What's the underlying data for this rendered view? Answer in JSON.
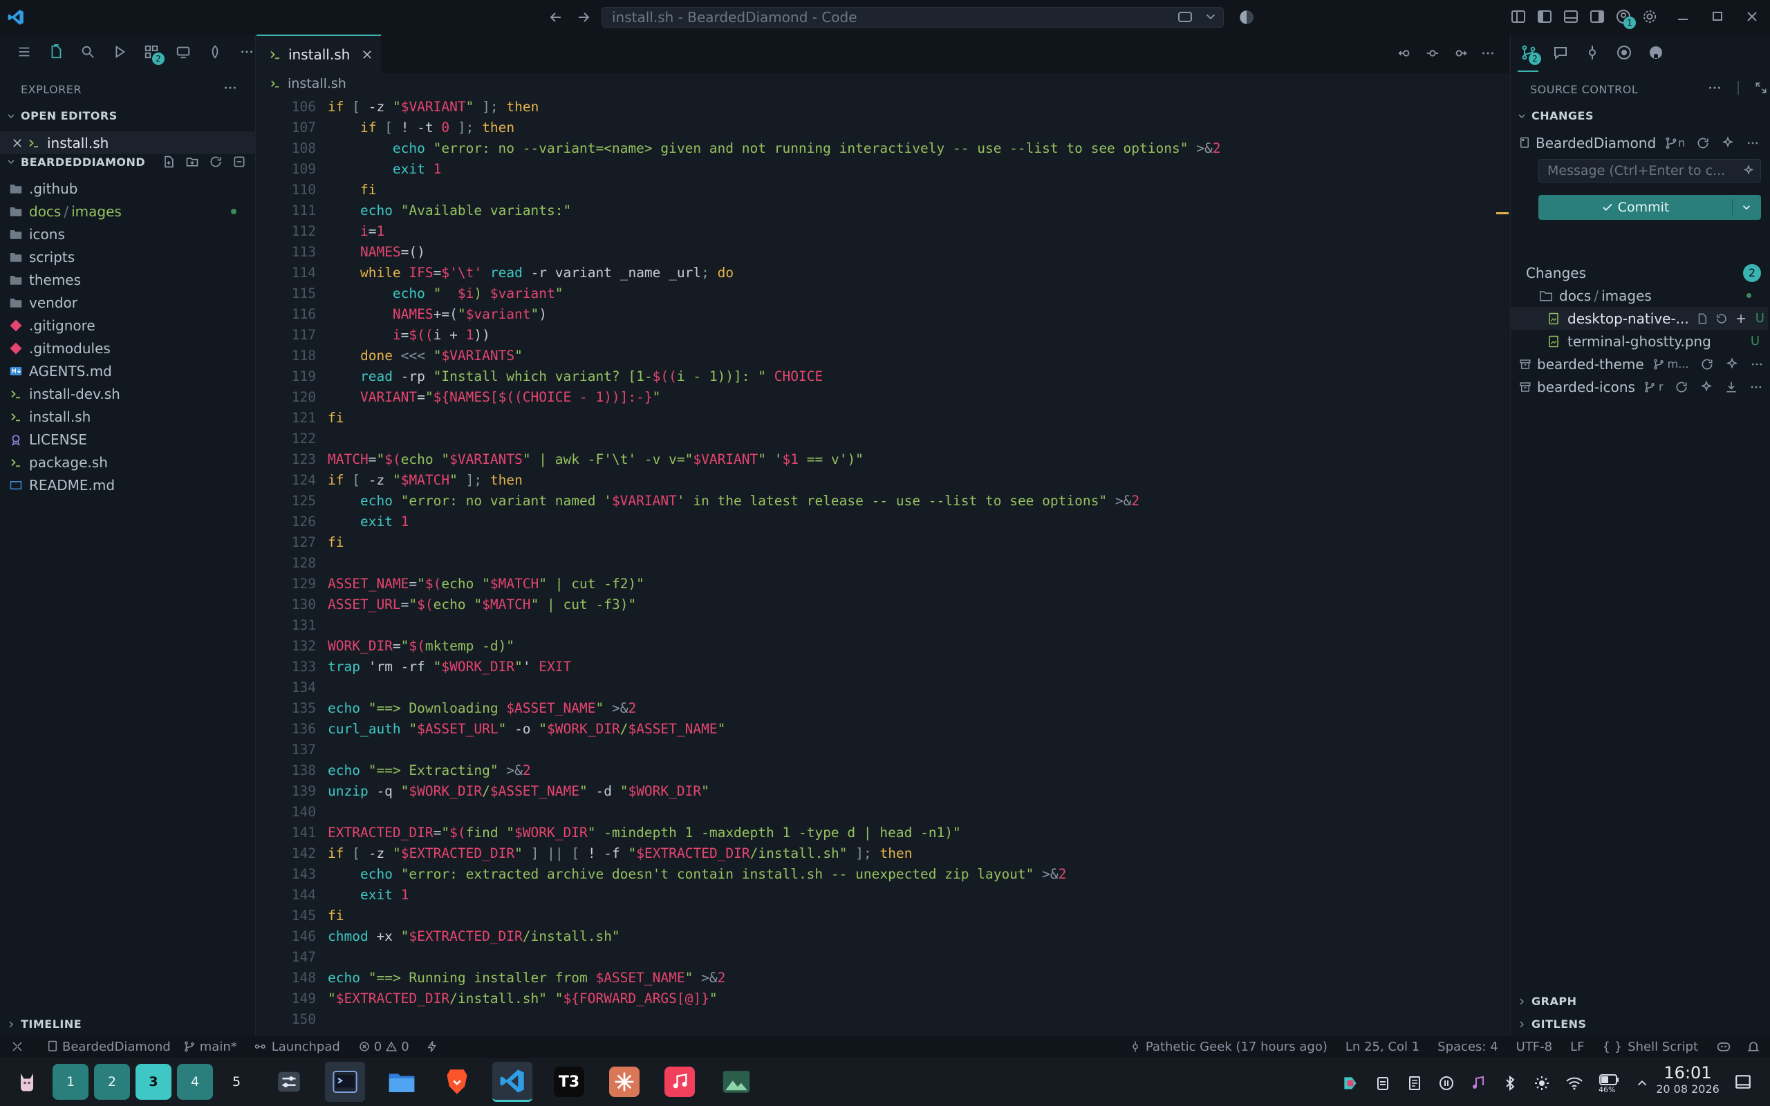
{
  "title_bar": {
    "search_text": "install.sh - BeardedDiamond - Code",
    "notification_count": "1"
  },
  "activity_bar": {
    "source_control_badge": "2"
  },
  "explorer": {
    "header": "EXPLORER",
    "open_editors_label": "OPEN EDITORS",
    "open_editor_file": "install.sh",
    "workspace_label": "BEARDEDDIAMOND",
    "folders": [
      ".github",
      "docs",
      "images",
      "icons",
      "scripts",
      "themes",
      "vendor"
    ],
    "path_sep": "/",
    "files": [
      ".gitignore",
      ".gitmodules",
      "AGENTS.md",
      "install-dev.sh",
      "install.sh",
      "LICENSE",
      "package.sh",
      "README.md"
    ],
    "timeline_label": "TIMELINE"
  },
  "editor": {
    "tab_label": "install.sh",
    "breadcrumb": "install.sh",
    "lines": [
      {
        "n": "106",
        "t": "if [ -z \"$VARIANT\" ]; then"
      },
      {
        "n": "107",
        "t": "    if [ ! -t 0 ]; then"
      },
      {
        "n": "108",
        "t": "        echo \"error: no --variant=<name> given and not running interactively -- use --list to see options\" >&2"
      },
      {
        "n": "109",
        "t": "        exit 1"
      },
      {
        "n": "110",
        "t": "    fi"
      },
      {
        "n": "111",
        "t": "    echo \"Available variants:\""
      },
      {
        "n": "112",
        "t": "    i=1"
      },
      {
        "n": "113",
        "t": "    NAMES=()"
      },
      {
        "n": "114",
        "t": "    while IFS=$'\\t' read -r variant _name _url; do"
      },
      {
        "n": "115",
        "t": "        echo \"  $i) $variant\""
      },
      {
        "n": "116",
        "t": "        NAMES+=(\"$variant\")"
      },
      {
        "n": "117",
        "t": "        i=$((i + 1))"
      },
      {
        "n": "118",
        "t": "    done <<< \"$VARIANTS\""
      },
      {
        "n": "119",
        "t": "    read -rp \"Install which variant? [1-$((i - 1))]: \" CHOICE"
      },
      {
        "n": "120",
        "t": "    VARIANT=\"${NAMES[$((CHOICE - 1))]:-}\""
      },
      {
        "n": "121",
        "t": "fi"
      },
      {
        "n": "122",
        "t": ""
      },
      {
        "n": "123",
        "t": "MATCH=\"$(echo \"$VARIANTS\" | awk -F'\\t' -v v=\"$VARIANT\" '$1 == v')\""
      },
      {
        "n": "124",
        "t": "if [ -z \"$MATCH\" ]; then"
      },
      {
        "n": "125",
        "t": "    echo \"error: no variant named '$VARIANT' in the latest release -- use --list to see options\" >&2"
      },
      {
        "n": "126",
        "t": "    exit 1"
      },
      {
        "n": "127",
        "t": "fi"
      },
      {
        "n": "128",
        "t": ""
      },
      {
        "n": "129",
        "t": "ASSET_NAME=\"$(echo \"$MATCH\" | cut -f2)\""
      },
      {
        "n": "130",
        "t": "ASSET_URL=\"$(echo \"$MATCH\" | cut -f3)\""
      },
      {
        "n": "131",
        "t": ""
      },
      {
        "n": "132",
        "t": "WORK_DIR=\"$(mktemp -d)\""
      },
      {
        "n": "133",
        "t": "trap 'rm -rf \"$WORK_DIR\"' EXIT"
      },
      {
        "n": "134",
        "t": ""
      },
      {
        "n": "135",
        "t": "echo \"==> Downloading $ASSET_NAME\" >&2"
      },
      {
        "n": "136",
        "t": "curl_auth \"$ASSET_URL\" -o \"$WORK_DIR/$ASSET_NAME\""
      },
      {
        "n": "137",
        "t": ""
      },
      {
        "n": "138",
        "t": "echo \"==> Extracting\" >&2"
      },
      {
        "n": "139",
        "t": "unzip -q \"$WORK_DIR/$ASSET_NAME\" -d \"$WORK_DIR\""
      },
      {
        "n": "140",
        "t": ""
      },
      {
        "n": "141",
        "t": "EXTRACTED_DIR=\"$(find \"$WORK_DIR\" -mindepth 1 -maxdepth 1 -type d | head -n1)\""
      },
      {
        "n": "142",
        "t": "if [ -z \"$EXTRACTED_DIR\" ] || [ ! -f \"$EXTRACTED_DIR/install.sh\" ]; then"
      },
      {
        "n": "143",
        "t": "    echo \"error: extracted archive doesn't contain install.sh -- unexpected zip layout\" >&2"
      },
      {
        "n": "144",
        "t": "    exit 1"
      },
      {
        "n": "145",
        "t": "fi"
      },
      {
        "n": "146",
        "t": "chmod +x \"$EXTRACTED_DIR/install.sh\""
      },
      {
        "n": "147",
        "t": ""
      },
      {
        "n": "148",
        "t": "echo \"==> Running installer from $ASSET_NAME\" >&2"
      },
      {
        "n": "149",
        "t": "\"$EXTRACTED_DIR/install.sh\" \"${FORWARD_ARGS[@]}\""
      },
      {
        "n": "150",
        "t": ""
      }
    ]
  },
  "scm": {
    "header": "SOURCE CONTROL",
    "changes_section": "CHANGES",
    "repo_name": "BeardedDiamond",
    "repo_branch_short": "n",
    "message_placeholder": "Message (Ctrl+Enter to c...",
    "commit_label": "Commit",
    "changes_label": "Changes",
    "changes_count": "2",
    "folder_path_a": "docs",
    "folder_path_b": "images",
    "path_sep": "/",
    "file1": "desktop-native-...",
    "file2": "terminal-ghostty.png",
    "status_untracked": "U",
    "repo2_name": "bearded-theme",
    "repo2_branch": "m...",
    "repo3_name": "bearded-icons",
    "repo3_branch": "r",
    "graph_label": "GRAPH",
    "gitlens_label": "GITLENS"
  },
  "status_bar": {
    "workspace": "BeardedDiamond",
    "branch": "main*",
    "launchpad": "Launchpad",
    "errors": "0",
    "warnings": "0",
    "blame": "Pathetic Geek (17 hours ago)",
    "position": "Ln 25, Col 1",
    "spaces": "Spaces: 4",
    "encoding": "UTF-8",
    "eol": "LF",
    "language": "Shell Script"
  },
  "taskbar": {
    "workspaces": [
      "1",
      "2",
      "3",
      "4",
      "5"
    ],
    "active_workspace": "3",
    "t3_label": "T3",
    "battery": "46%",
    "time": "16:01",
    "date": "20 08 2026"
  },
  "colors": {
    "accent": "#3bb3b0",
    "keyword": "#e5b449",
    "string": "#94c25f",
    "variable": "#e5456f",
    "builtin": "#3ec7c4"
  }
}
